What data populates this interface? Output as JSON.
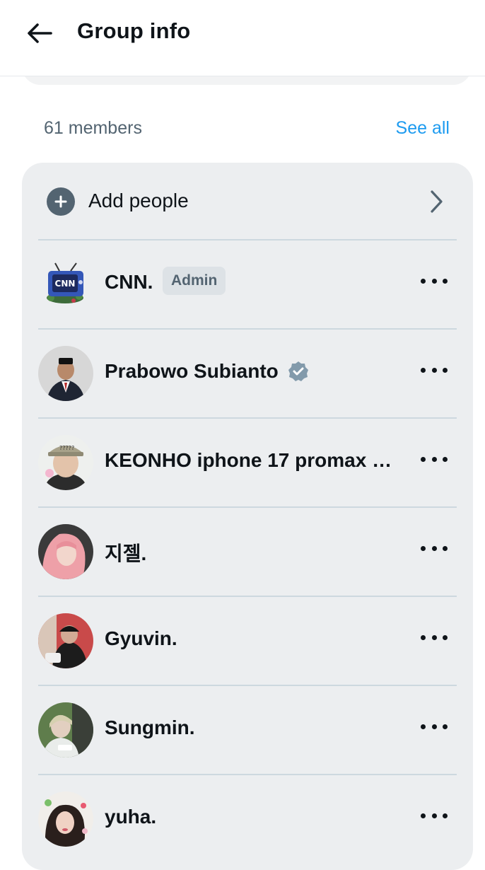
{
  "header": {
    "back_icon": "arrow-left-icon",
    "title": "Group info"
  },
  "members_section": {
    "count_label": "61 members",
    "see_all_label": "See all"
  },
  "add_people": {
    "icon": "plus-circle-icon",
    "label": "Add people"
  },
  "members": [
    {
      "name": "CNN.",
      "badge": "Admin",
      "avatar": "cnn-tv-logo"
    },
    {
      "name": "Prabowo Subianto",
      "verified": true,
      "avatar": "man-in-suit-photo"
    },
    {
      "name": "KEONHO iphone 17 promax …",
      "avatar": "person-with-hat-photo"
    },
    {
      "name": "지젤.",
      "avatar": "pink-hair-photo"
    },
    {
      "name": "Gyuvin.",
      "avatar": "person-red-background-photo"
    },
    {
      "name": "Sungmin.",
      "avatar": "green-tint-photo"
    },
    {
      "name": "yuha.",
      "avatar": "person-with-stickers-photo"
    }
  ],
  "colors": {
    "accent": "#1d9bf0",
    "card_bg": "#eceef0",
    "muted_text": "#536471",
    "verified_badge": "#829aab"
  }
}
